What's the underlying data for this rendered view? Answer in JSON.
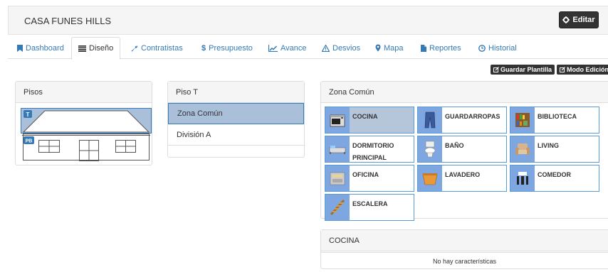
{
  "header": {
    "title": "CASA FUNES HILLS",
    "edit_label": "Editar"
  },
  "tabs": [
    {
      "label": "Dashboard",
      "icon": "bookmark-icon"
    },
    {
      "label": "Diseño",
      "icon": "list-icon"
    },
    {
      "label": "Contratistas",
      "icon": "wrench-icon"
    },
    {
      "label": "Presupuesto",
      "icon": "dollar-icon"
    },
    {
      "label": "Avance",
      "icon": "chart-icon"
    },
    {
      "label": "Desvios",
      "icon": "warning-icon"
    },
    {
      "label": "Mapa",
      "icon": "map-marker-icon"
    },
    {
      "label": "Reportes",
      "icon": "file-icon"
    },
    {
      "label": "Historial",
      "icon": "clock-icon"
    }
  ],
  "toolbar": {
    "save_template": "Guardar Plantilla",
    "edit_mode": "Modo Edición"
  },
  "floors_panel": {
    "title": "Pisos",
    "top_floor_badge": "T",
    "ground_floor_badge": "PB"
  },
  "floor_panel": {
    "title": "Piso T",
    "items": [
      {
        "label": "Zona Común",
        "active": true
      },
      {
        "label": "División A",
        "active": false
      }
    ]
  },
  "zone_panel": {
    "title": "Zona Común",
    "zones": [
      {
        "label": "COCINA",
        "icon": "stove-icon",
        "active": true
      },
      {
        "label": "GUARDARROPAS",
        "icon": "wardrobe-icon",
        "active": false
      },
      {
        "label": "BIBLIOTECA",
        "icon": "bookshelf-icon",
        "active": false
      },
      {
        "label": "DORMITORIO PRINCIPAL",
        "icon": "bed-icon",
        "active": false
      },
      {
        "label": "BAÑO",
        "icon": "toilet-icon",
        "active": false
      },
      {
        "label": "LIVING",
        "icon": "armchair-icon",
        "active": false
      },
      {
        "label": "OFICINA",
        "icon": "filing-cabinet-icon",
        "active": false
      },
      {
        "label": "LAVADERO",
        "icon": "laundry-basket-icon",
        "active": false
      },
      {
        "label": "COMEDOR",
        "icon": "dining-icon",
        "active": false
      },
      {
        "label": "ESCALERA",
        "icon": "stairs-icon",
        "active": false
      }
    ]
  },
  "detail_panel": {
    "title": "COCINA",
    "empty_text": "No hay características"
  }
}
